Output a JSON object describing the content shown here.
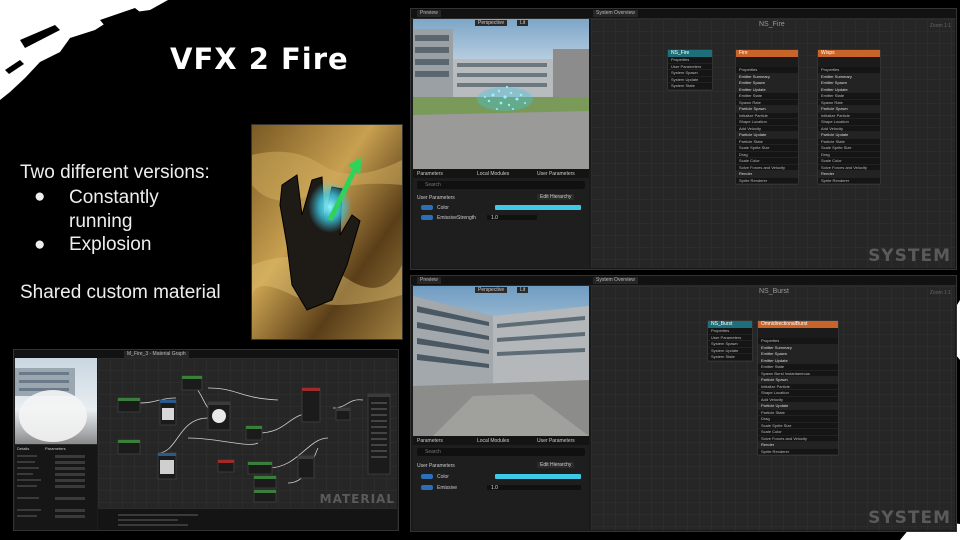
{
  "slide": {
    "title": "VFX 2 Fire",
    "intro": "Two different versions:",
    "bullets": [
      "Constantly running",
      "Explosion"
    ],
    "footer": "Shared custom material"
  },
  "material_editor": {
    "tab_label": "M_Fire_3 - Material Graph",
    "watermark": "MATERIAL",
    "details_tab": "Details",
    "parameters_tab": "Parameters"
  },
  "fire_editor": {
    "preview_tab": "Preview",
    "system_overview_tab": "System Overview",
    "graph_title": "NS_Fire",
    "zoom": "Zoom 1:1",
    "viewport_buttons": [
      "Perspective",
      "Lit"
    ],
    "watermark": "SYSTEM",
    "bottom_tabs": [
      "Parameters",
      "Local Modules",
      "User Parameters"
    ],
    "search_placeholder": "Search",
    "user_parameters_label": "User Parameters",
    "edit_hierarchy": "Edit Hierarchy",
    "params": [
      {
        "name": "Color",
        "value": ""
      },
      {
        "name": "EmissiveStrength",
        "value": "1.0"
      }
    ],
    "system_node": {
      "title": "NS_Fire",
      "rows": [
        "Properties",
        "User Parameters",
        "System Spawn",
        "System Update",
        "System State"
      ]
    },
    "emitters": [
      {
        "title": "Fire",
        "rows": [
          "Properties",
          "Emitter Summary",
          "Emitter Spawn",
          "Emitter Update",
          "Emitter State",
          "Spawn Rate",
          "Particle Spawn",
          "Initialize Particle",
          "Shape Location",
          "Add Velocity",
          "Particle Update",
          "Particle State",
          "Scale Sprite Size",
          "Drag",
          "Scale Color",
          "Solve Forces and Velocity",
          "Render",
          "Sprite Renderer"
        ]
      },
      {
        "title": "Wisps",
        "rows": [
          "Properties",
          "Emitter Summary",
          "Emitter Spawn",
          "Emitter Update",
          "Emitter State",
          "Spawn Rate",
          "Particle Spawn",
          "Initialize Particle",
          "Shape Location",
          "Add Velocity",
          "Particle Update",
          "Particle State",
          "Scale Sprite Size",
          "Drag",
          "Scale Color",
          "Solve Forces and Velocity",
          "Render",
          "Sprite Renderer"
        ]
      }
    ]
  },
  "burst_editor": {
    "preview_tab": "Preview",
    "system_overview_tab": "System Overview",
    "graph_title": "NS_Burst",
    "zoom": "Zoom 1:1",
    "viewport_buttons": [
      "Perspective",
      "Lit"
    ],
    "watermark": "SYSTEM",
    "bottom_tabs": [
      "Parameters",
      "Local Modules",
      "User Parameters"
    ],
    "search_placeholder": "Search",
    "user_parameters_label": "User Parameters",
    "edit_hierarchy": "Edit Hierarchy",
    "params": [
      {
        "name": "Color",
        "value": ""
      },
      {
        "name": "Emissive",
        "value": "1.0"
      }
    ],
    "system_node": {
      "title": "NS_Burst",
      "rows": [
        "Properties",
        "User Parameters",
        "System Spawn",
        "System Update",
        "System State"
      ]
    },
    "emitter": {
      "title": "OmnidirectionalBurst",
      "rows": [
        "Properties",
        "Emitter Summary",
        "Emitter Spawn",
        "Emitter Update",
        "Emitter State",
        "Spawn Burst Instantaneous",
        "Particle Spawn",
        "Initialize Particle",
        "Shape Location",
        "Add Velocity",
        "Particle Update",
        "Particle State",
        "Drag",
        "Scale Sprite Size",
        "Scale Color",
        "Solve Forces and Velocity",
        "Render",
        "Sprite Renderer"
      ]
    }
  },
  "colors": {
    "accent_cyan": "#3ec9e6",
    "emitter_orange": "#c8642a",
    "system_teal": "#1f6f7a",
    "arrow_green": "#2fd35a"
  }
}
